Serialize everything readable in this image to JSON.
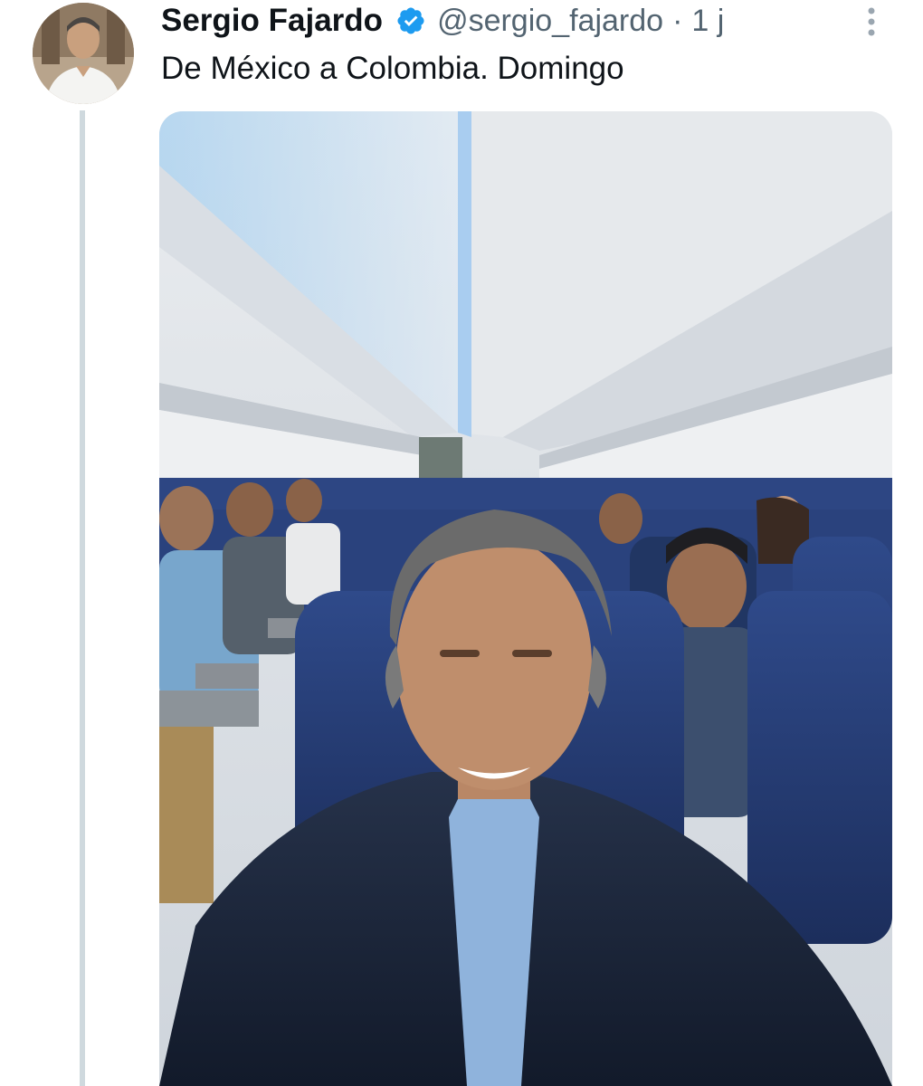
{
  "tweet": {
    "author_name": "Sergio Fajardo",
    "verified_icon": "verified-badge-icon",
    "handle": "@sergio_fajardo",
    "separator": "·",
    "time": "1 j",
    "more_icon": "more-vertical-icon",
    "text": "De México a Colombia. Domingo",
    "media_description_icon": "photo"
  },
  "colors": {
    "name": "#0f1419",
    "secondary": "#536471",
    "verified": "#1d9bf0",
    "thread_line": "#cfd9de"
  }
}
